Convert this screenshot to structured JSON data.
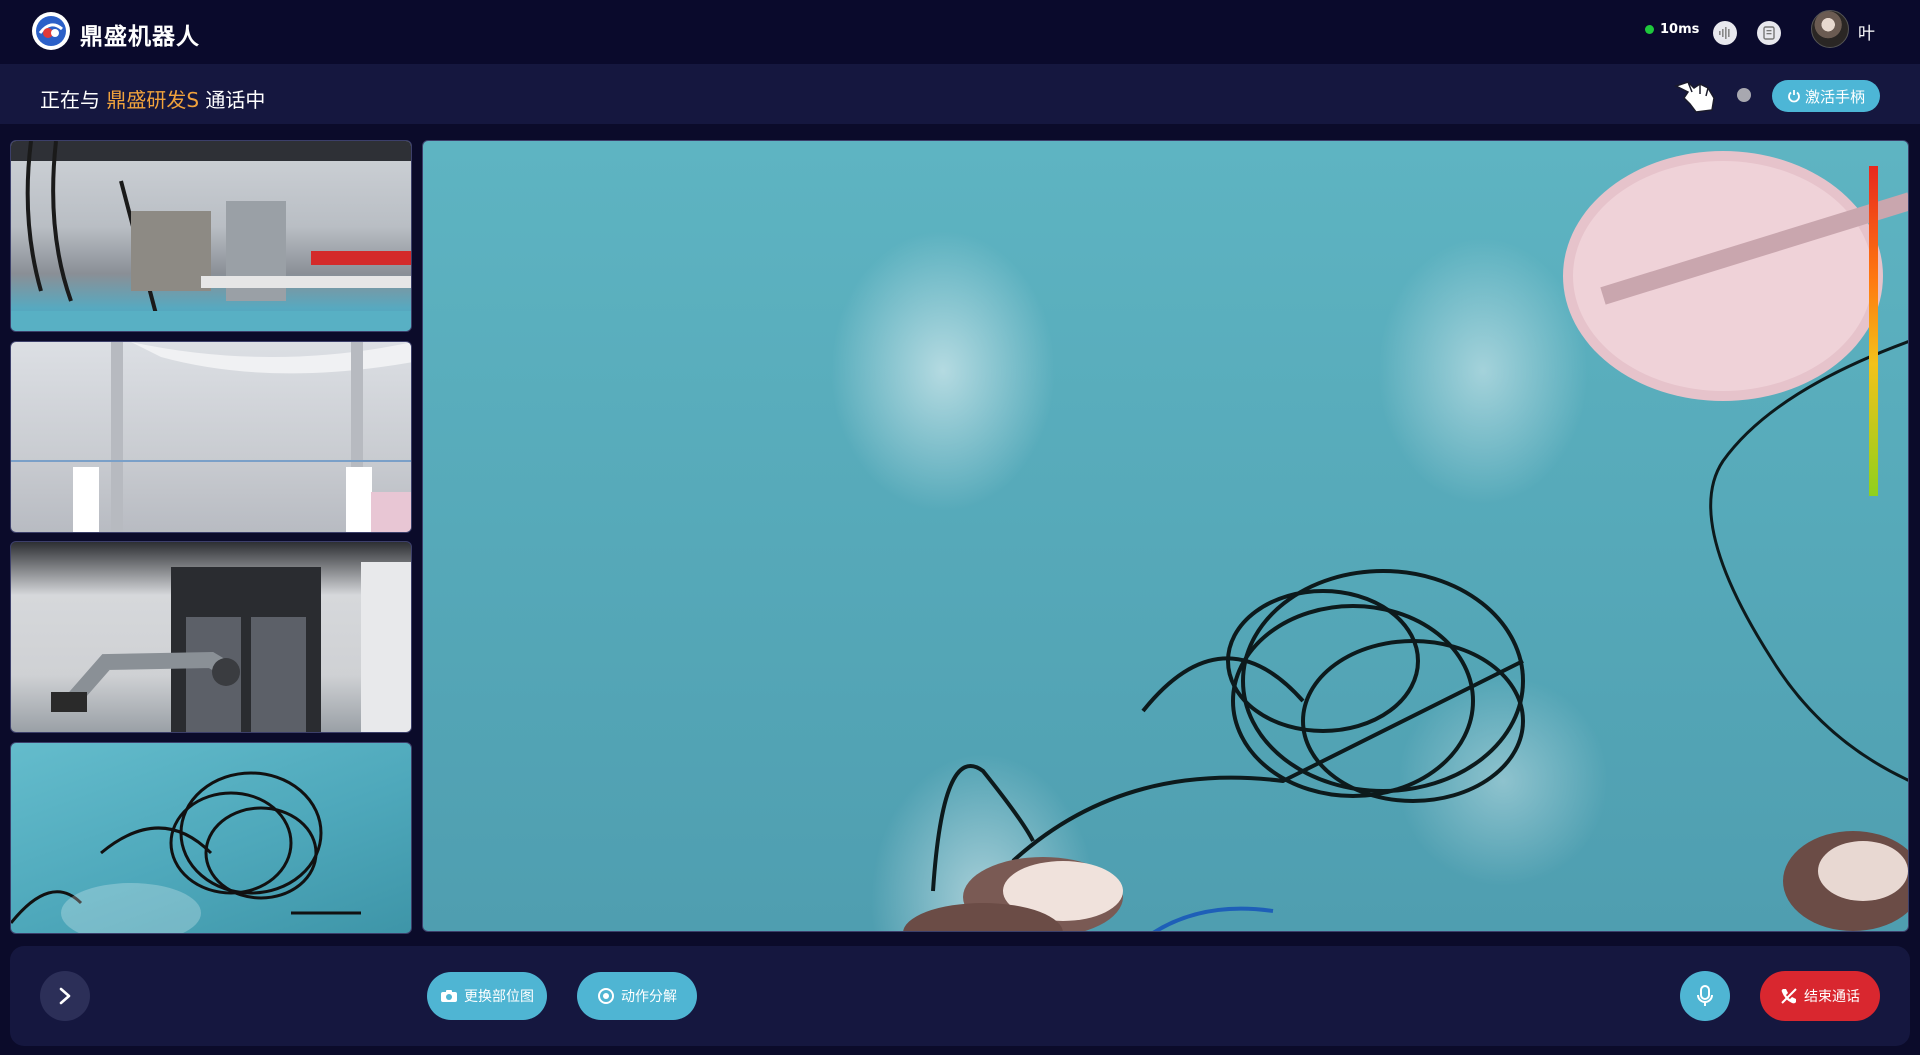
{
  "header": {
    "brand": "鼎盛机器人",
    "latency": "10ms",
    "user_name": "叶",
    "icons": [
      "logo-icon",
      "audio-wave-icon",
      "document-icon",
      "user-avatar"
    ],
    "colors": {
      "latency_ok": "#1ec83c"
    }
  },
  "call": {
    "prefix": "正在与",
    "peer": "鼎盛研发S",
    "suffix": "通话中",
    "activate_label": "激活手柄",
    "icons": [
      "hand-gesture-icon",
      "power-icon"
    ],
    "colors": {
      "peer": "#f0a23c",
      "accent": "#4db6d6"
    }
  },
  "video": {
    "thumbnails": [
      "camera-1",
      "camera-2",
      "camera-3",
      "camera-4"
    ]
  },
  "controls": {
    "change_view_label": "更换部位图",
    "motion_label": "动作分解",
    "end_call_label": "结束通话",
    "icons": [
      "chevron-right-icon",
      "camera-icon",
      "target-icon",
      "microphone-icon",
      "phone-end-icon"
    ],
    "colors": {
      "end_call": "#d9272f",
      "action": "#4fb5d3"
    }
  }
}
